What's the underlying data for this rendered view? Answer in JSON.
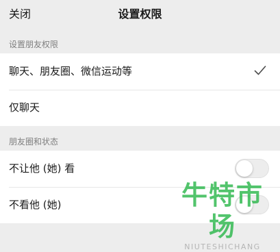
{
  "nav": {
    "close_label": "关闭",
    "title": "设置权限"
  },
  "section_permissions": {
    "header": "设置朋友权限",
    "options": [
      {
        "label": "聊天、朋友圈、微信运动等",
        "selected": true
      },
      {
        "label": "仅聊天",
        "selected": false
      }
    ]
  },
  "section_moments": {
    "header": "朋友圈和状态",
    "toggles": [
      {
        "label": "不让他 (她) 看",
        "on": false
      },
      {
        "label": "不看他 (她)",
        "on": false
      }
    ]
  },
  "watermark": {
    "main": "牛特市场",
    "sub": "NIUTESHICHANG"
  },
  "colors": {
    "background": "#ededed",
    "row_background": "#ffffff",
    "watermark_green": "#2db84d"
  },
  "icons": {
    "check": "check-icon"
  }
}
